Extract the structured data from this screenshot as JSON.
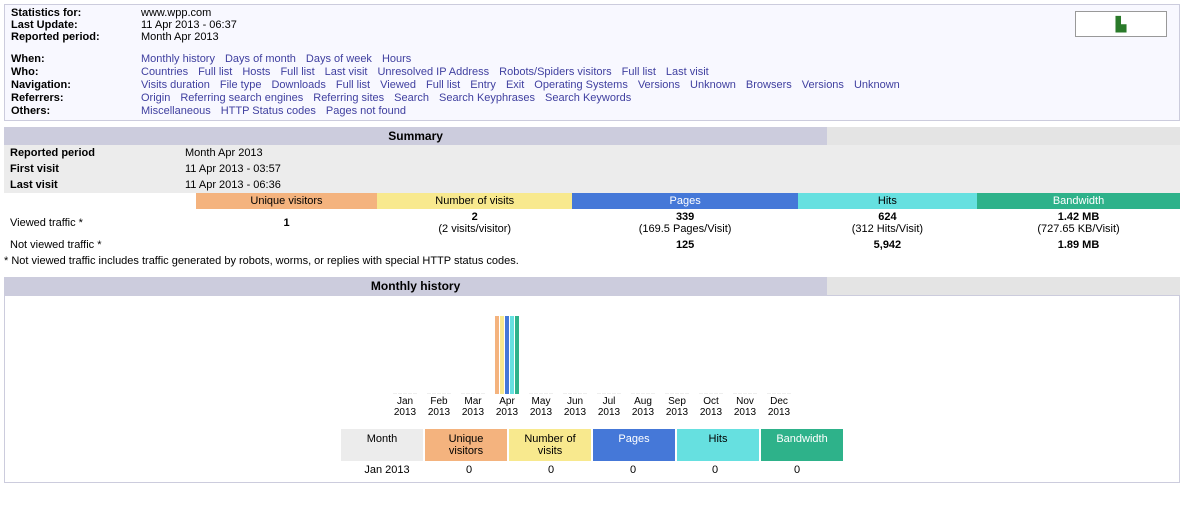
{
  "header": {
    "stats_for_label": "Statistics for:",
    "stats_for_value": "www.wpp.com",
    "last_update_label": "Last Update:",
    "last_update_value": "11 Apr 2013 - 06:37",
    "reported_period_label": "Reported period:",
    "reported_period_value": "Month Apr 2013"
  },
  "nav": {
    "when": {
      "label": "When:",
      "links": [
        "Monthly history",
        "Days of month",
        "Days of week",
        "Hours"
      ]
    },
    "who": {
      "label": "Who:",
      "links": [
        "Countries",
        "Full list",
        "Hosts",
        "Full list",
        "Last visit",
        "Unresolved IP Address",
        "Robots/Spiders visitors",
        "Full list",
        "Last visit"
      ]
    },
    "navigation": {
      "label": "Navigation:",
      "links": [
        "Visits duration",
        "File type",
        "Downloads",
        "Full list",
        "Viewed",
        "Full list",
        "Entry",
        "Exit",
        "Operating Systems",
        "Versions",
        "Unknown",
        "Browsers",
        "Versions",
        "Unknown"
      ]
    },
    "referrers": {
      "label": "Referrers:",
      "links": [
        "Origin",
        "Referring search engines",
        "Referring sites",
        "Search",
        "Search Keyphrases",
        "Search Keywords"
      ]
    },
    "others": {
      "label": "Others:",
      "links": [
        "Miscellaneous",
        "HTTP Status codes",
        "Pages not found"
      ]
    }
  },
  "summary": {
    "title": "Summary",
    "reported_period": {
      "label": "Reported period",
      "value": "Month Apr 2013"
    },
    "first_visit": {
      "label": "First visit",
      "value": "11 Apr 2013 - 03:57"
    },
    "last_visit": {
      "label": "Last visit",
      "value": "11 Apr 2013 - 06:36"
    },
    "cols": {
      "uv": "Unique visitors",
      "nv": "Number of visits",
      "pages": "Pages",
      "hits": "Hits",
      "bw": "Bandwidth"
    },
    "viewed_label": "Viewed traffic *",
    "not_viewed_label": "Not viewed traffic *",
    "viewed": {
      "uv": "1",
      "nv": "2",
      "nv_sub": "(2 visits/visitor)",
      "pages": "339",
      "pages_sub": "(169.5 Pages/Visit)",
      "hits": "624",
      "hits_sub": "(312 Hits/Visit)",
      "bw": "1.42 MB",
      "bw_sub": "(727.65 KB/Visit)"
    },
    "not_viewed": {
      "pages": "125",
      "hits": "5,942",
      "bw": "1.89 MB"
    },
    "footnote": "* Not viewed traffic includes traffic generated by robots, worms, or replies with special HTTP status codes."
  },
  "monthly": {
    "title": "Monthly history",
    "months": [
      "Jan",
      "Feb",
      "Mar",
      "Apr",
      "May",
      "Jun",
      "Jul",
      "Aug",
      "Sep",
      "Oct",
      "Nov",
      "Dec"
    ],
    "year": "2013",
    "legend": {
      "month": "Month",
      "uv": "Unique visitors",
      "nv": "Number of visits",
      "pages": "Pages",
      "hits": "Hits",
      "bw": "Bandwidth"
    },
    "row1": {
      "month": "Jan 2013",
      "uv": "0",
      "nv": "0",
      "pages": "0",
      "hits": "0",
      "bw": "0"
    }
  },
  "chart_data": {
    "type": "bar",
    "categories": [
      "Jan 2013",
      "Feb 2013",
      "Mar 2013",
      "Apr 2013",
      "May 2013",
      "Jun 2013",
      "Jul 2013",
      "Aug 2013",
      "Sep 2013",
      "Oct 2013",
      "Nov 2013",
      "Dec 2013"
    ],
    "series": [
      {
        "name": "Unique visitors",
        "values": [
          0,
          0,
          0,
          1,
          0,
          0,
          0,
          0,
          0,
          0,
          0,
          0
        ]
      },
      {
        "name": "Number of visits",
        "values": [
          0,
          0,
          0,
          2,
          0,
          0,
          0,
          0,
          0,
          0,
          0,
          0
        ]
      },
      {
        "name": "Pages",
        "values": [
          0,
          0,
          0,
          339,
          0,
          0,
          0,
          0,
          0,
          0,
          0,
          0
        ]
      },
      {
        "name": "Hits",
        "values": [
          0,
          0,
          0,
          624,
          0,
          0,
          0,
          0,
          0,
          0,
          0,
          0
        ]
      },
      {
        "name": "Bandwidth (MB)",
        "values": [
          0,
          0,
          0,
          1.42,
          0,
          0,
          0,
          0,
          0,
          0,
          0,
          0
        ]
      }
    ]
  }
}
